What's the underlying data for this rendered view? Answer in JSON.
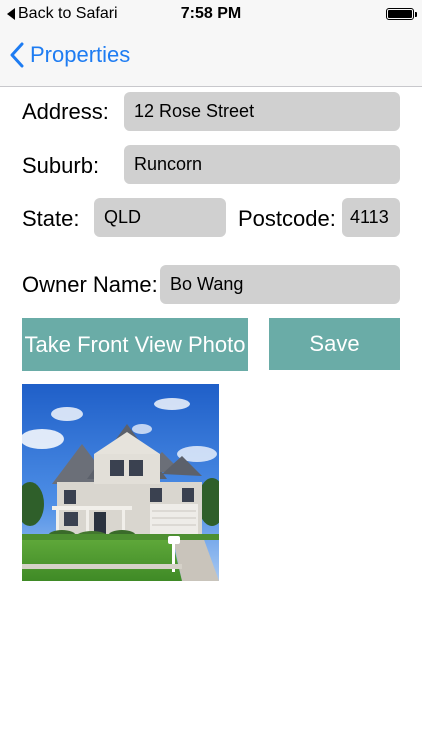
{
  "status_bar": {
    "back_label": "Back to Safari",
    "time": "7:58 PM"
  },
  "nav": {
    "back_label": "Properties"
  },
  "form": {
    "address_label": "Address:",
    "address_value": "12 Rose Street",
    "suburb_label": "Suburb:",
    "suburb_value": "Runcorn",
    "state_label": "State:",
    "state_value": "QLD",
    "postcode_label": "Postcode:",
    "postcode_value": "4113",
    "owner_label": "Owner Name:",
    "owner_value": "Bo Wang"
  },
  "actions": {
    "photo_button_label": "Take Front View Photo",
    "save_button_label": "Save"
  },
  "colors": {
    "accent": "#1e7cf2",
    "button": "#6aaca7",
    "field": "#d0d0d0"
  },
  "icons": {
    "back": "chevron-left-icon",
    "battery": "battery-icon"
  }
}
